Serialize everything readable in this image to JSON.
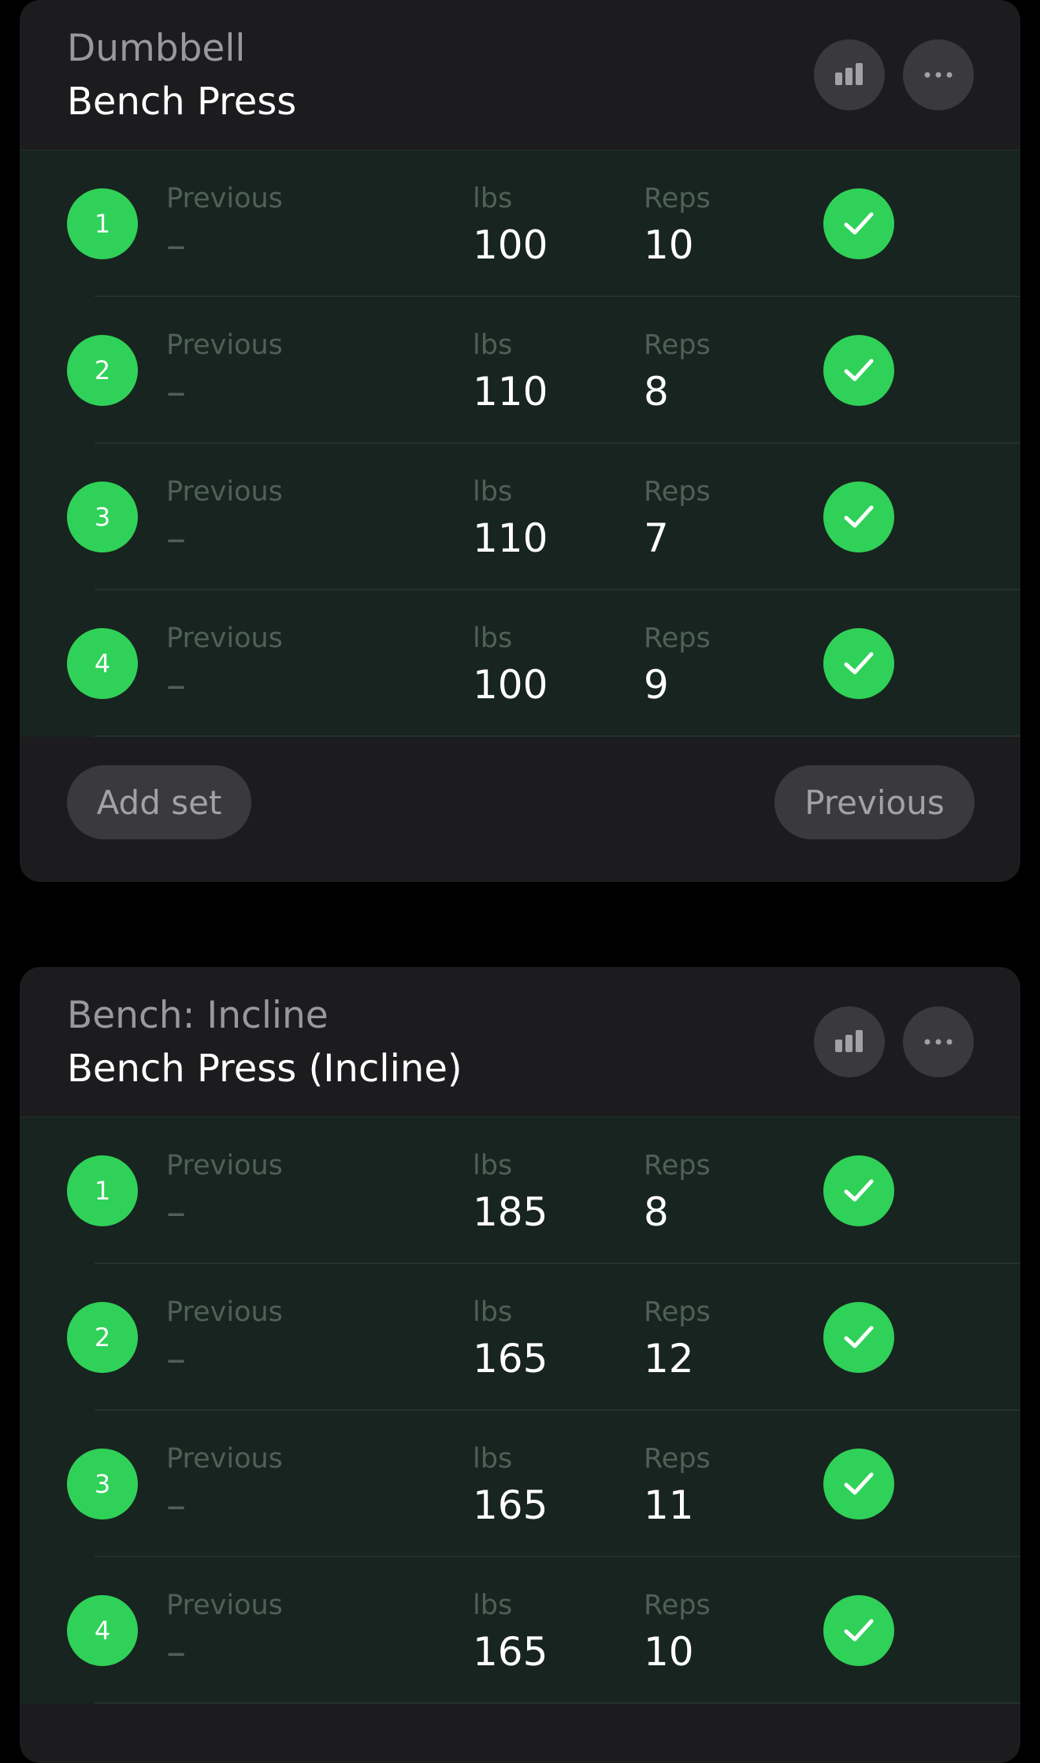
{
  "colors": {
    "background": "#000000",
    "card": "#1c1c1e",
    "completed_row": "#18241f",
    "accent_green": "#30d158",
    "button": "#3a3a3c"
  },
  "labels": {
    "previous": "Previous",
    "weight_unit": "lbs",
    "reps": "Reps"
  },
  "exercises": [
    {
      "category": "Dumbbell",
      "name": "Bench Press",
      "stats_icon": "bar-chart-icon",
      "more_icon": "ellipsis-icon",
      "sets": [
        {
          "number": "1",
          "previous": "–",
          "weight": "100",
          "reps": "10",
          "completed": true
        },
        {
          "number": "2",
          "previous": "–",
          "weight": "110",
          "reps": "8",
          "completed": true
        },
        {
          "number": "3",
          "previous": "–",
          "weight": "110",
          "reps": "7",
          "completed": true
        },
        {
          "number": "4",
          "previous": "–",
          "weight": "100",
          "reps": "9",
          "completed": true
        }
      ],
      "add_set_label": "Add set",
      "previous_button_label": "Previous"
    },
    {
      "category": "Bench: Incline",
      "name": "Bench Press (Incline)",
      "stats_icon": "bar-chart-icon",
      "more_icon": "ellipsis-icon",
      "sets": [
        {
          "number": "1",
          "previous": "–",
          "weight": "185",
          "reps": "8",
          "completed": true
        },
        {
          "number": "2",
          "previous": "–",
          "weight": "165",
          "reps": "12",
          "completed": true
        },
        {
          "number": "3",
          "previous": "–",
          "weight": "165",
          "reps": "11",
          "completed": true
        },
        {
          "number": "4",
          "previous": "–",
          "weight": "165",
          "reps": "10",
          "completed": true
        }
      ]
    }
  ]
}
